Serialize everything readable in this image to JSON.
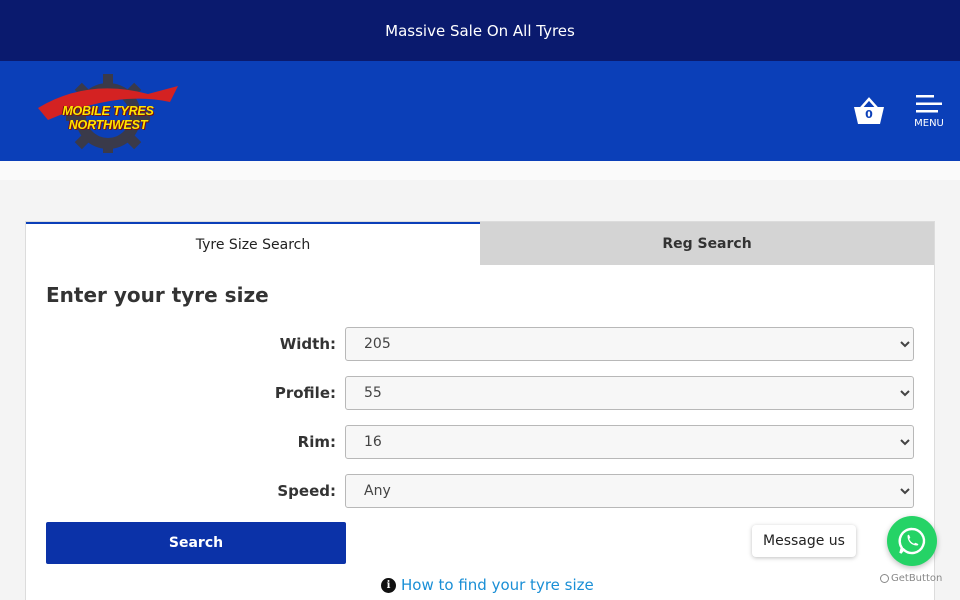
{
  "promo": {
    "text": "Massive Sale On All Tyres"
  },
  "header": {
    "logo_text": "MOBILE TYRES NORTHWEST",
    "basket_count": "0",
    "menu_label": "MENU"
  },
  "tabs": [
    {
      "label": "Tyre Size Search"
    },
    {
      "label": "Reg Search"
    }
  ],
  "form": {
    "title": "Enter your tyre size",
    "fields": [
      {
        "label": "Width:",
        "value": "205"
      },
      {
        "label": "Profile:",
        "value": "55"
      },
      {
        "label": "Rim:",
        "value": "16"
      },
      {
        "label": "Speed:",
        "value": "Any"
      }
    ],
    "search_label": "Search",
    "help_link": "How to find your tyre size",
    "info_glyph": "i"
  },
  "chat": {
    "bubble": "Message us",
    "credit": "GetButton"
  },
  "colors": {
    "promo_bg": "#0a1a6e",
    "header_bg": "#0b3fb8",
    "button_bg": "#0b32a8",
    "whatsapp": "#25d366",
    "link": "#1a8fd6"
  },
  "icons": {
    "basket": "basket-icon",
    "menu": "hamburger-icon",
    "info": "info-icon",
    "whatsapp": "whatsapp-icon"
  }
}
